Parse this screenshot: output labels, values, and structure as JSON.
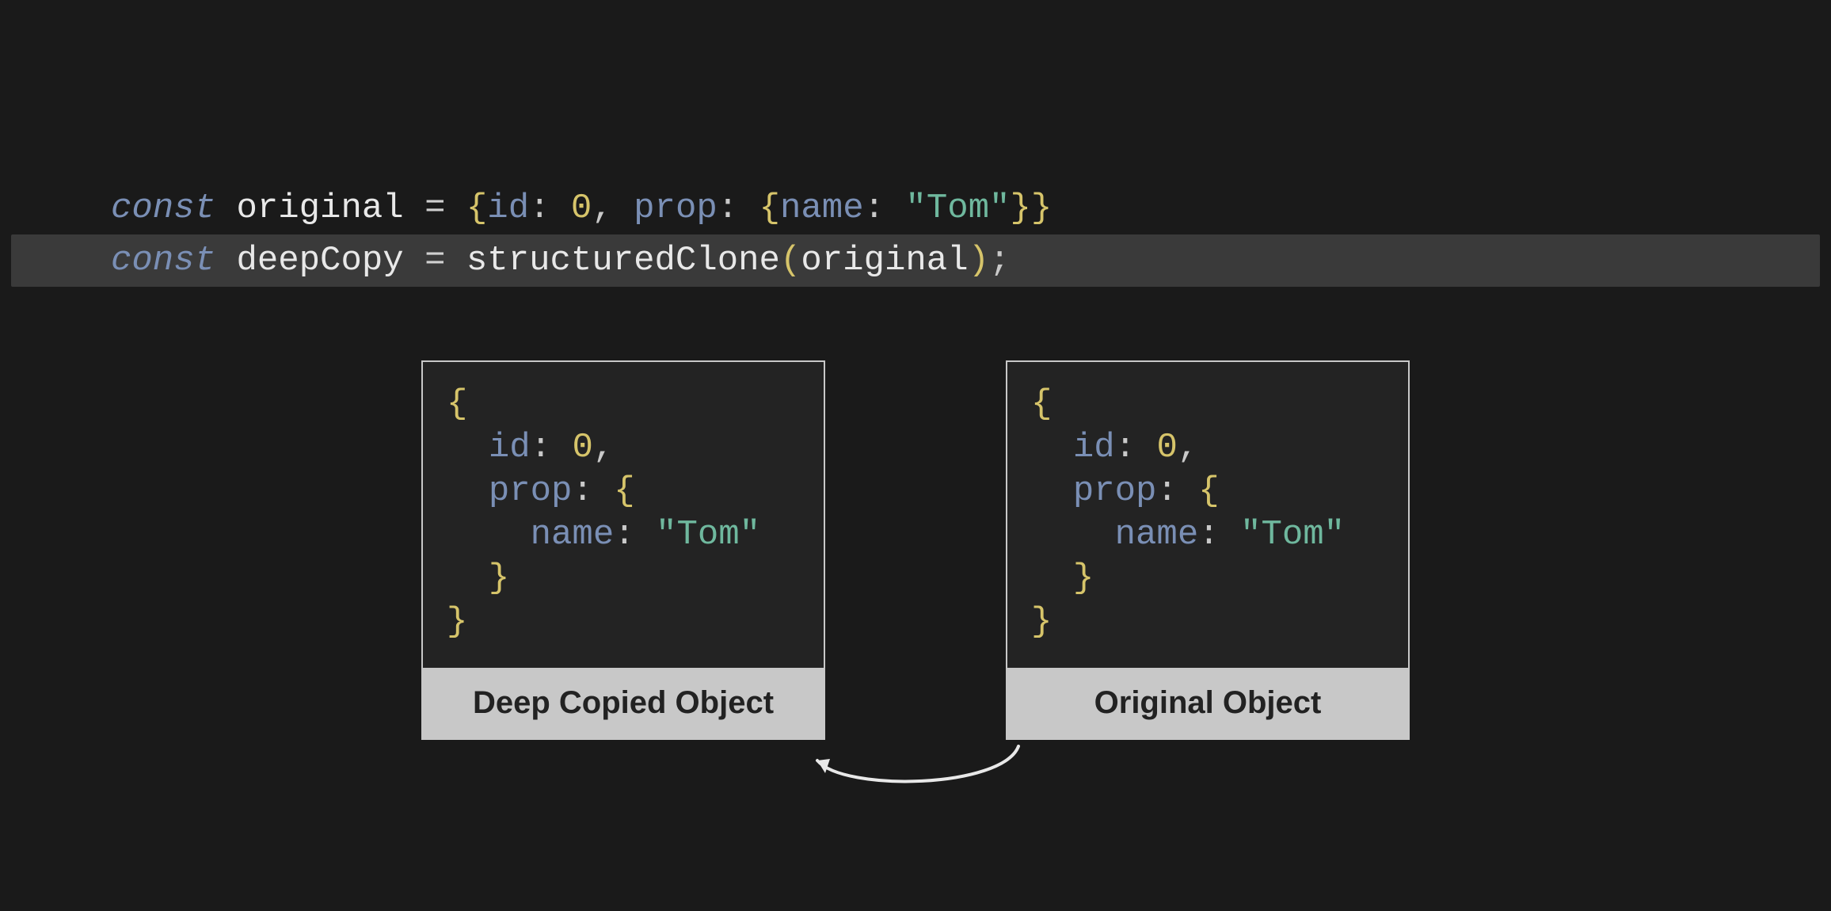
{
  "code": {
    "line1": {
      "kw": "const",
      "ident": "original",
      "eq": " = ",
      "lbrace": "{",
      "p_id": "id",
      "colon1": ": ",
      "v_id": "0",
      "comma1": ", ",
      "p_prop": "prop",
      "colon2": ": ",
      "lbrace2": "{",
      "p_name": "name",
      "colon3": ": ",
      "v_name": "\"Tom\"",
      "rbrace2": "}",
      "rbrace": "}"
    },
    "line2": {
      "kw": "const",
      "ident": "deepCopy",
      "eq": " = ",
      "fn": "structuredClone",
      "lparen": "(",
      "arg": "original",
      "rparen": ")",
      "semi": ";"
    }
  },
  "boxes": {
    "left": {
      "label": "Deep Copied Object",
      "obj": {
        "lbrace": "{",
        "p_id": "id",
        "colon1": ": ",
        "v_id": "0",
        "comma1": ",",
        "p_prop": "prop",
        "colon2": ": ",
        "lbrace2": "{",
        "p_name": "name",
        "colon3": ": ",
        "v_name": "\"Tom\"",
        "rbrace2": "}",
        "rbrace": "}"
      }
    },
    "right": {
      "label": "Original Object",
      "obj": {
        "lbrace": "{",
        "p_id": "id",
        "colon1": ": ",
        "v_id": "0",
        "comma1": ",",
        "p_prop": "prop",
        "colon2": ": ",
        "lbrace2": "{",
        "p_name": "name",
        "colon3": ": ",
        "v_name": "\"Tom\"",
        "rbrace2": "}",
        "rbrace": "}"
      }
    }
  },
  "colors": {
    "bg": "#1a1a1a",
    "highlight": "#3a3a3a",
    "border": "#c8c8c8",
    "labelBg": "#c8c8c8",
    "labelText": "#222222",
    "keyword": "#7a8fb5",
    "identifier": "#e8e8e8",
    "number": "#d6c46a",
    "string": "#6fb89e",
    "brace": "#d6c46a"
  }
}
